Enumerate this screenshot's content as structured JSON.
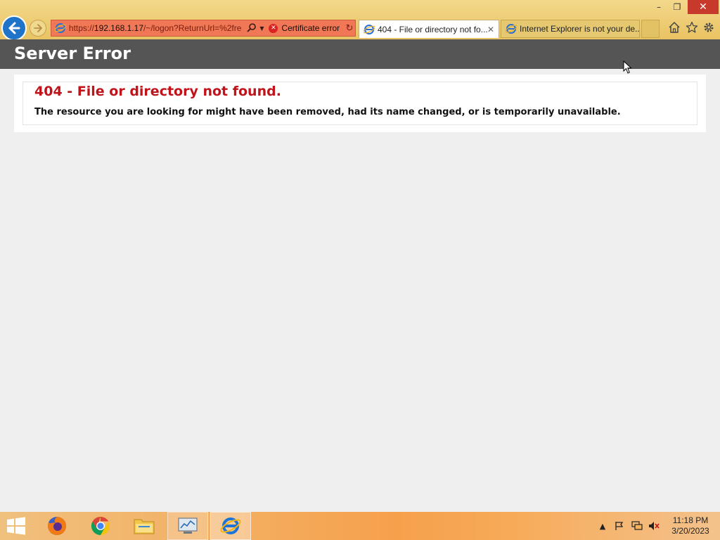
{
  "window": {
    "minimize_glyph": "–",
    "restore_glyph": "❐",
    "close_glyph": "✕"
  },
  "addressbar": {
    "url_prefix": "https://",
    "url_host": "192.168.1.17",
    "url_path": "/~/logon?ReturnUrl=%2fre",
    "certificate_error_label": "Certificate error"
  },
  "tabs": [
    {
      "label": "404 - File or directory not fo...",
      "active": true
    },
    {
      "label": "Internet Explorer is not your de...",
      "active": false
    }
  ],
  "page": {
    "header_title": "Server Error",
    "error_title": "404 - File or directory not found.",
    "error_description": "The resource you are looking for might have been removed, had its name changed, or is temporarily unavailable."
  },
  "taskbar": {
    "apps": [
      "start-icon",
      "firefox-icon",
      "chrome-icon",
      "file-explorer-icon",
      "resource-monitor-icon",
      "internet-explorer-icon"
    ],
    "clock_time": "11:18 PM",
    "clock_date": "3/20/2023"
  },
  "colors": {
    "address_bar_error": "#f07856",
    "error_title": "#c0141c",
    "header_bg": "#555555",
    "back_button": "#1f74c9"
  }
}
